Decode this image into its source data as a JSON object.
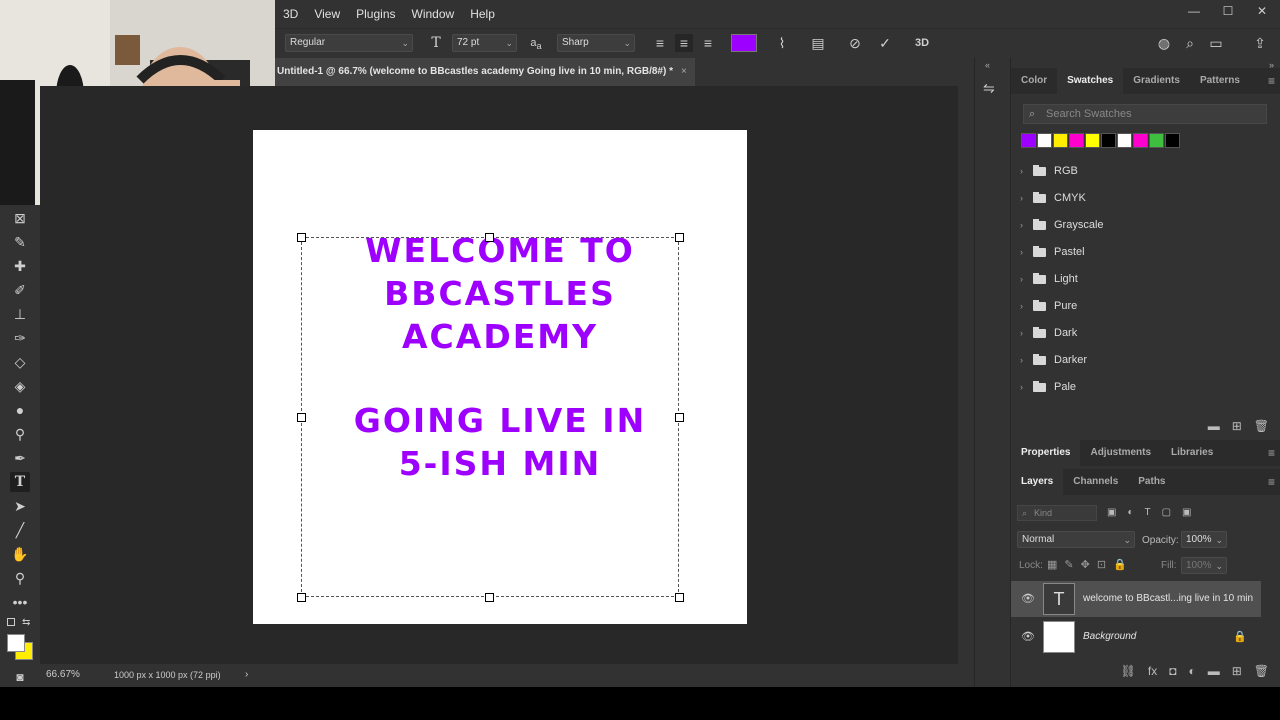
{
  "menubar": {
    "items": [
      "3D",
      "View",
      "Plugins",
      "Window",
      "Help"
    ]
  },
  "window_controls": {
    "minimize": "—",
    "maximize": "☐",
    "close": "✕"
  },
  "options_bar": {
    "font_style": "Regular",
    "font_size": "72 pt",
    "antialias": "Sharp",
    "text_color": "#9d00ff"
  },
  "document_tab": {
    "title": "Untitled-1 @ 66.7% (welcome to BBcastles academy  Going live in 10 min, RGB/8#) *",
    "close": "×"
  },
  "document": {
    "lines": [
      "WELCOME TO",
      "BBCASTLES",
      "ACADEMY",
      "",
      "GOING LIVE IN",
      "5-ISH MIN"
    ]
  },
  "status_bar": {
    "zoom": "66.67%",
    "doc_size": "1000 px x 1000 px (72 ppi)"
  },
  "swatch_panel": {
    "tabs": [
      "Color",
      "Swatches",
      "Gradients",
      "Patterns"
    ],
    "search_placeholder": "Search Swatches",
    "colors": [
      "#9d00ff",
      "#ffffff",
      "#ffee00",
      "#ff00cc",
      "#ffff00",
      "#000000",
      "#ffffff",
      "#ff00cc",
      "#3fbf3f",
      "#000000"
    ],
    "folders": [
      "RGB",
      "CMYK",
      "Grayscale",
      "Pastel",
      "Light",
      "Pure",
      "Dark",
      "Darker",
      "Pale"
    ]
  },
  "properties_tabs": [
    "Properties",
    "Adjustments",
    "Libraries"
  ],
  "layers_panel": {
    "tabs": [
      "Layers",
      "Channels",
      "Paths"
    ],
    "filter_placeholder": "Kind",
    "blend_mode": "Normal",
    "opacity_label": "Opacity:",
    "opacity_value": "100%",
    "lock_label": "Lock:",
    "fill_label": "Fill:",
    "fill_value": "100%",
    "layers": [
      {
        "name": "welcome to BBcastl...ing live in 10 min",
        "type": "text"
      },
      {
        "name": "Background",
        "type": "background"
      }
    ]
  }
}
